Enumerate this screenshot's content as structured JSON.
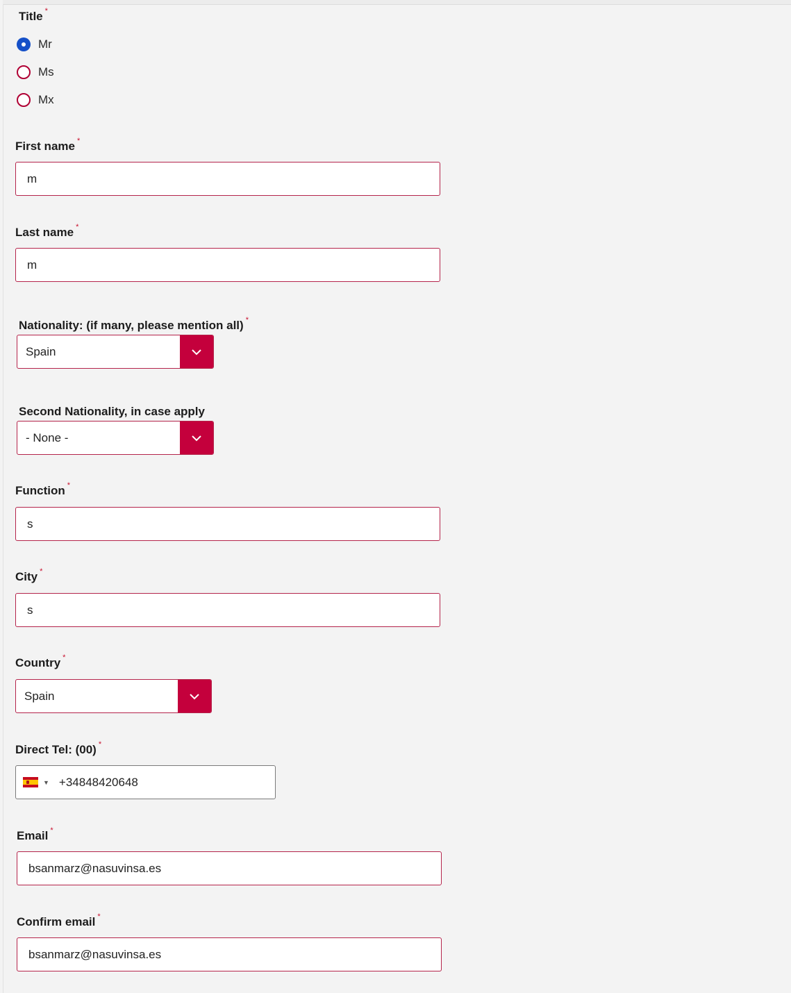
{
  "form": {
    "title_field": {
      "label": "Title",
      "required_mark": "*",
      "options": [
        {
          "label": "Mr",
          "checked": true
        },
        {
          "label": "Ms",
          "checked": false
        },
        {
          "label": "Mx",
          "checked": false
        }
      ]
    },
    "first_name": {
      "label": "First name",
      "required_mark": "*",
      "value": "m"
    },
    "last_name": {
      "label": "Last name",
      "required_mark": "*",
      "value": "m"
    },
    "nationality": {
      "label": "Nationality: (if many, please mention all)",
      "required_mark": "*",
      "selected": "Spain"
    },
    "second_nationality": {
      "label": "Second Nationality, in case apply",
      "selected": "- None -"
    },
    "function": {
      "label": "Function",
      "required_mark": "*",
      "value": "s"
    },
    "city": {
      "label": "City",
      "required_mark": "*",
      "value": "s"
    },
    "country": {
      "label": "Country",
      "required_mark": "*",
      "selected": "Spain"
    },
    "direct_tel": {
      "label": "Direct Tel: (00)",
      "required_mark": "*",
      "country_flag": "spain-flag-icon",
      "value": "+34848420648"
    },
    "email": {
      "label": "Email",
      "required_mark": "*",
      "value": "bsanmarz@nasuvinsa.es"
    },
    "confirm_email": {
      "label": "Confirm email",
      "required_mark": "*",
      "value": "bsanmarz@nasuvinsa.es"
    }
  },
  "colors": {
    "accent": "#c4003c",
    "input_border": "#b4234a",
    "radio_checked": "#1550c8",
    "required_mark": "#c8102e",
    "background": "#f3f3f3"
  },
  "icons": {
    "dropdown": "chevron-down-icon",
    "phone_country": "spain-flag-icon"
  }
}
